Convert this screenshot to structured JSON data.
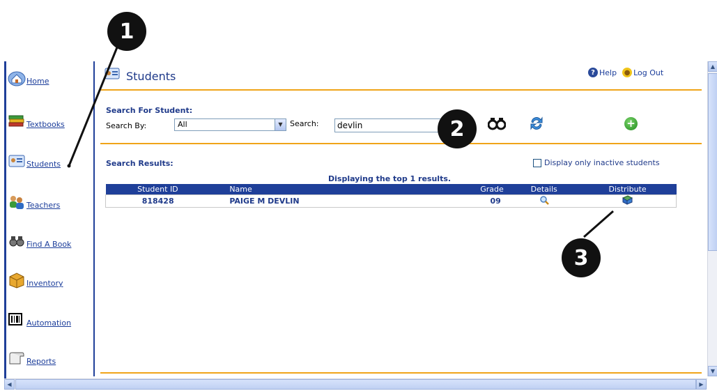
{
  "sidebar": {
    "items": [
      {
        "label": "Home",
        "icon": "home-icon"
      },
      {
        "label": "Textbooks",
        "icon": "books-icon"
      },
      {
        "label": "Students",
        "icon": "student-card-icon"
      },
      {
        "label": "Teachers",
        "icon": "teachers-icon"
      },
      {
        "label": "Find A Book",
        "icon": "binoculars-icon"
      },
      {
        "label": "Inventory",
        "icon": "box-icon"
      },
      {
        "label": "Automation",
        "icon": "barcode-icon"
      },
      {
        "label": "Reports",
        "icon": "scroll-icon"
      }
    ]
  },
  "header": {
    "title": "Students",
    "help_label": "Help",
    "logout_label": "Log Out"
  },
  "search": {
    "heading": "Search For Student:",
    "search_by_label": "Search By:",
    "search_by_value": "All",
    "search_label": "Search:",
    "search_value": "devlin"
  },
  "results": {
    "heading": "Search Results:",
    "inactive_label": "Display only inactive students",
    "displaying_text": "Displaying the top 1 results.",
    "columns": [
      "Student ID",
      "Name",
      "Grade",
      "Details",
      "Distribute"
    ],
    "rows": [
      {
        "student_id": "818428",
        "name": "PAIGE M DEVLIN",
        "grade": "09"
      }
    ]
  },
  "callouts": [
    "1",
    "2",
    "3"
  ],
  "colors": {
    "nav_blue": "#1f3f99",
    "accent_orange": "#f0a419",
    "link_blue": "#1a3c9a"
  }
}
